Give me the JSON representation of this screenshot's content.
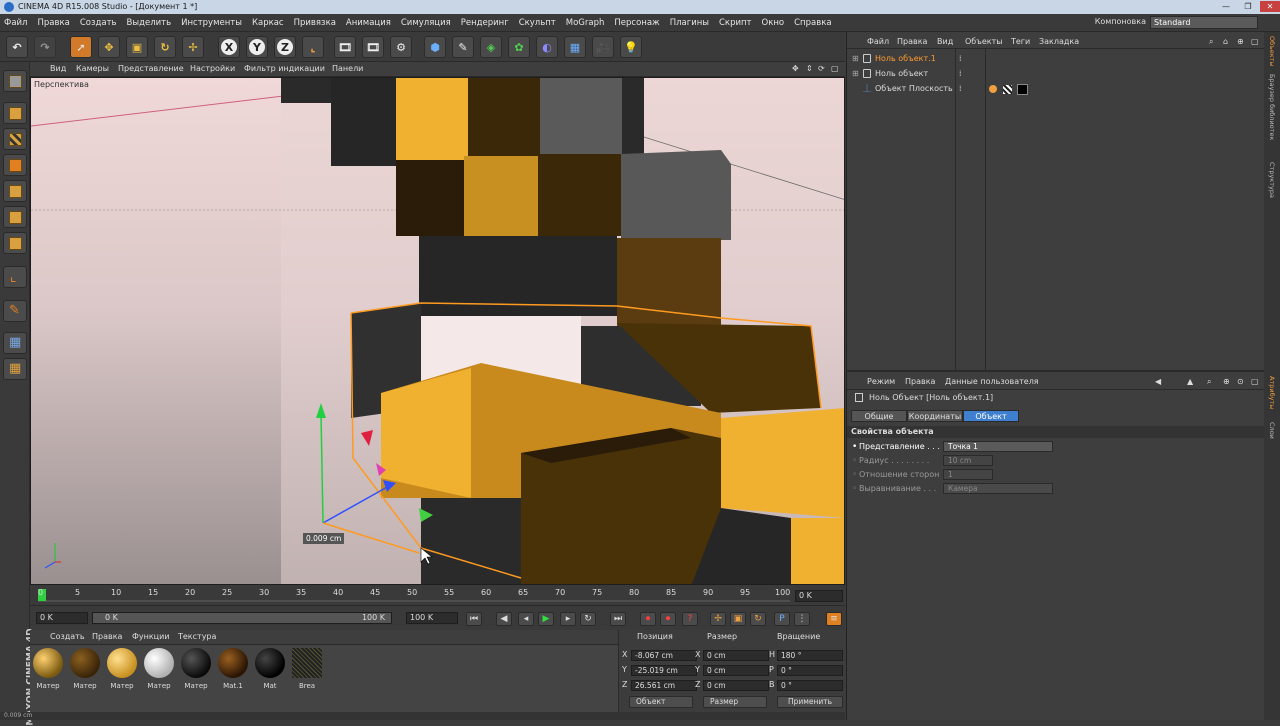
{
  "window": {
    "title": "CINEMA 4D R15.008 Studio - [Документ 1 *]"
  },
  "menubar": {
    "items": [
      "Файл",
      "Правка",
      "Создать",
      "Выделить",
      "Инструменты",
      "Каркас",
      "Привязка",
      "Анимация",
      "Симуляция",
      "Рендеринг",
      "Скульпт",
      "MoGraph",
      "Персонаж",
      "Плагины",
      "Скрипт",
      "Окно",
      "Справка"
    ],
    "layout_label": "Компоновка",
    "layout_value": "Standard"
  },
  "toolbar": {
    "axis_x": "X",
    "axis_y": "Y",
    "axis_z": "Z"
  },
  "viewport": {
    "menu": [
      "Вид",
      "Камеры",
      "Представление",
      "Настройки",
      "Фильтр индикации",
      "Панели"
    ],
    "camera_label": "Перспектива",
    "measure_label": "0.009 cm"
  },
  "timeline": {
    "ticks": [
      "0",
      "5",
      "10",
      "15",
      "20",
      "25",
      "30",
      "35",
      "40",
      "45",
      "50",
      "55",
      "60",
      "65",
      "70",
      "75",
      "80",
      "85",
      "90",
      "95",
      "100"
    ],
    "current_frame": "0 K",
    "start": "0 K",
    "range_start": "0 K",
    "range_end": "100 K",
    "end": "100 K"
  },
  "materials": {
    "menu": [
      "Создать",
      "Правка",
      "Функции",
      "Текстура"
    ],
    "items": [
      {
        "label": "Матер",
        "color": "#7a5a10"
      },
      {
        "label": "Матер",
        "color": "#3a2408"
      },
      {
        "label": "Матер",
        "color": "#c89020"
      },
      {
        "label": "Матер",
        "color": "#e8e8e8"
      },
      {
        "label": "Матер",
        "color": "#1a1a1a"
      },
      {
        "label": "Mat.1",
        "color": "#4a2a08"
      },
      {
        "label": "Mat",
        "color": "#101010"
      },
      {
        "label": "Brea",
        "color": "#202020"
      }
    ],
    "brand": "MAXON CINEMA 4D"
  },
  "coordinates": {
    "headers": [
      "Позиция",
      "Размер",
      "Вращение"
    ],
    "rows": [
      {
        "axis": "X",
        "pos": "-8.067 cm",
        "size_axis": "X",
        "size": "0 cm",
        "rot_axis": "H",
        "rot": "180 °"
      },
      {
        "axis": "Y",
        "pos": "-25.019 cm",
        "size_axis": "Y",
        "size": "0 cm",
        "rot_axis": "P",
        "rot": "0 °"
      },
      {
        "axis": "Z",
        "pos": "26.561 cm",
        "size_axis": "Z",
        "size": "0 cm",
        "rot_axis": "B",
        "rot": "0 °"
      }
    ],
    "mode_object": "Объект",
    "mode_size": "Размер",
    "apply": "Применить"
  },
  "status": {
    "text": "0.009 cm"
  },
  "object_manager": {
    "menu": [
      "Файл",
      "Правка",
      "Вид",
      "Объекты",
      "Теги",
      "Закладка"
    ],
    "objects": [
      {
        "name": "Ноль объект.1",
        "selected": true
      },
      {
        "name": "Ноль объект",
        "selected": false
      },
      {
        "name": "Объект Плоскость",
        "selected": false
      }
    ]
  },
  "attribute_manager": {
    "menu": [
      "Режим",
      "Правка",
      "Данные пользователя"
    ],
    "header": "Ноль Объект [Ноль объект.1]",
    "tabs": [
      "Общие",
      "Координаты",
      "Объект"
    ],
    "section": "Свойства объекта",
    "props": [
      {
        "label": "Представление . . . .",
        "value": "Точка 1"
      },
      {
        "label": "Радиус . . . . . . . .",
        "value": "10 cm"
      },
      {
        "label": "Отношение сторон",
        "value": "1"
      },
      {
        "label": "Выравнивание . . .",
        "value": "Камера"
      }
    ]
  },
  "side_tabs": [
    "Объекты",
    "Браузер библиотек",
    "Структура",
    "Атрибуты",
    "Слои"
  ]
}
